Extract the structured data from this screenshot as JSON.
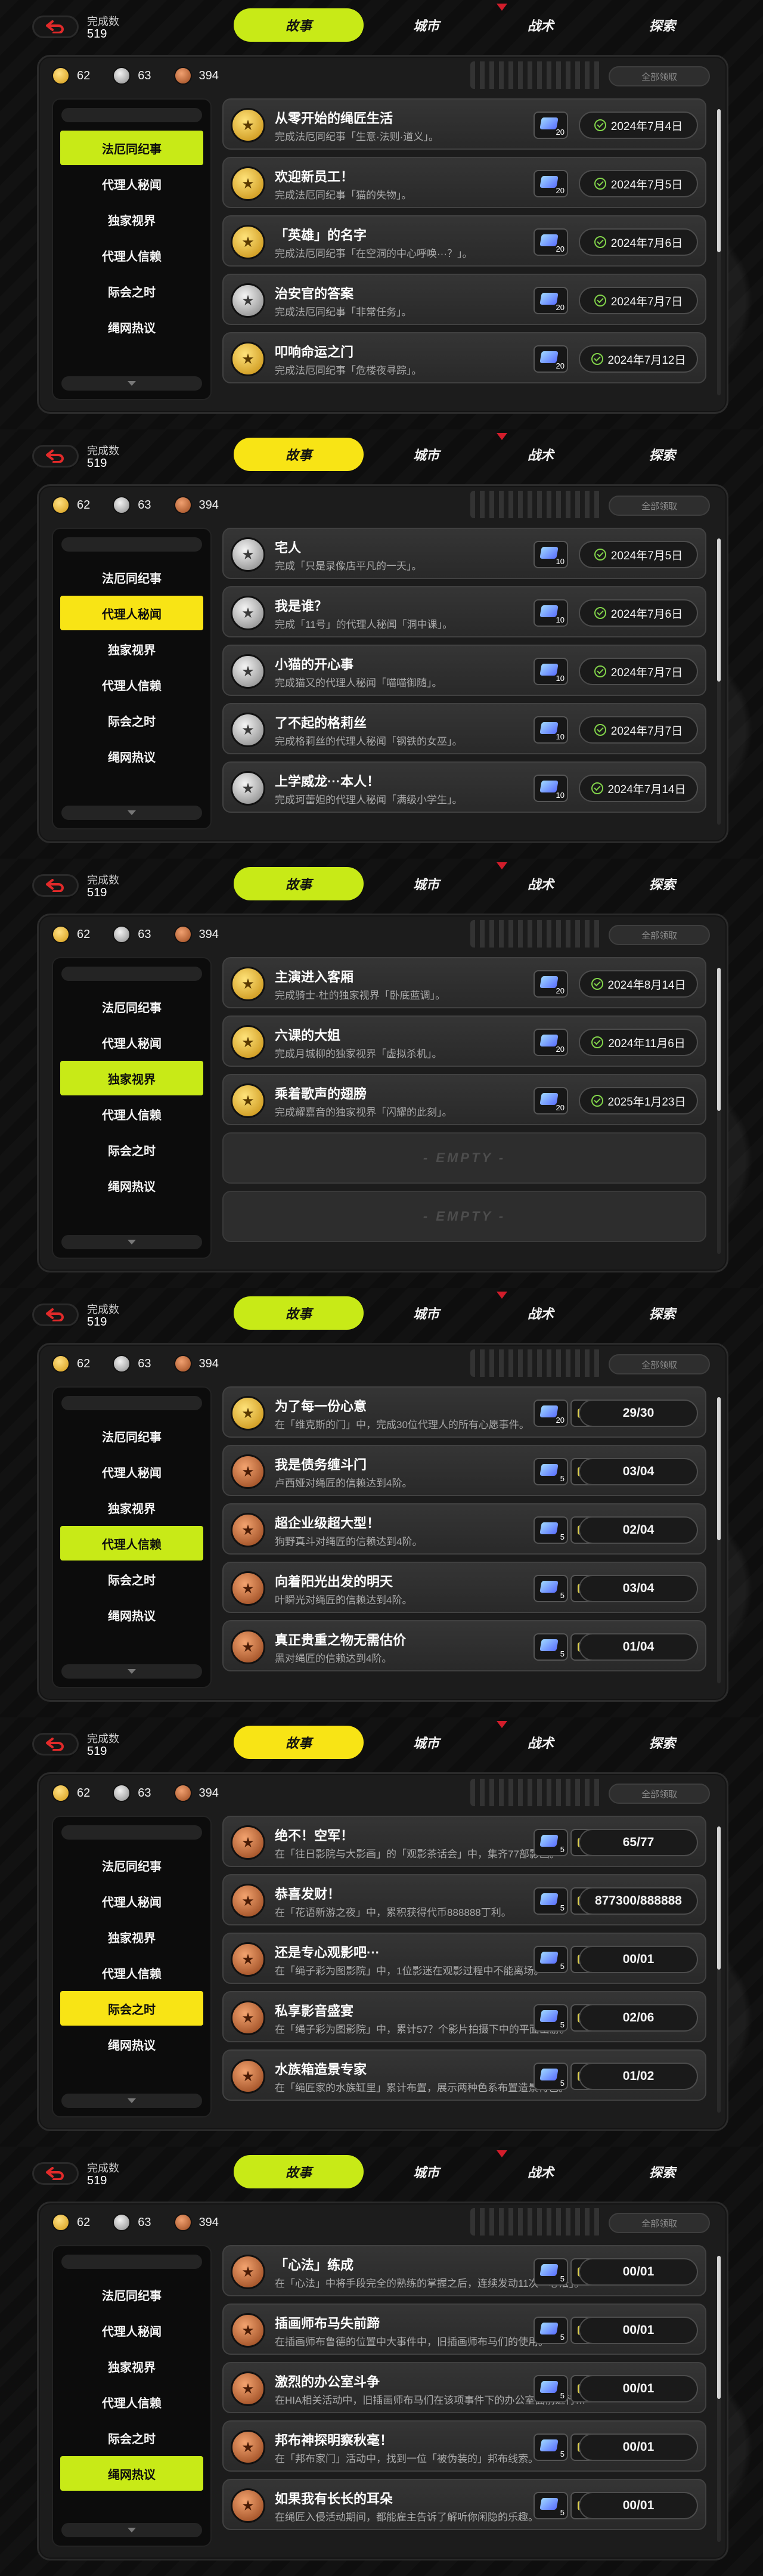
{
  "common": {
    "progress_label": "完成数",
    "progress_value": "519",
    "tabs": [
      "故事",
      "城市",
      "战术",
      "探索"
    ],
    "currencies": [
      {
        "icon": "gold-medal-icon",
        "count": "62"
      },
      {
        "icon": "silver-medal-icon",
        "count": "63"
      },
      {
        "icon": "bronze-medal-icon",
        "count": "394"
      }
    ],
    "claim_all": "全部领取",
    "categories": [
      "法厄同纪事",
      "代理人秘闻",
      "独家视界",
      "代理人信赖",
      "际会之时",
      "绳网热议"
    ],
    "empty_label": "- EMPTY -"
  },
  "colors": {
    "accent_lime": "#c8ea17",
    "accent_yellow": "#f8e415",
    "marker_red": "#d21d2b",
    "complete_check": "#82d44a"
  },
  "panels": [
    {
      "active_tab": 0,
      "active_category": 0,
      "active_color": "#c8ea17",
      "items": [
        {
          "medal": "gold",
          "title": "从零开始的绳匠生活",
          "desc": "完成法厄同纪事「生意·法则·道义」。",
          "reward": "20",
          "status": "2024年7月4日",
          "done": true
        },
        {
          "medal": "gold",
          "title": "欢迎新员工！",
          "desc": "完成法厄同纪事「猫的失物」。",
          "reward": "20",
          "status": "2024年7月5日",
          "done": true
        },
        {
          "medal": "gold",
          "title": "「英雄」的名字",
          "desc": "完成法厄同纪事「在空洞的中心呼唤···？」。",
          "reward": "20",
          "status": "2024年7月6日",
          "done": true
        },
        {
          "medal": "silver",
          "title": "治安官的答案",
          "desc": "完成法厄同纪事「非常任务」。",
          "reward": "20",
          "status": "2024年7月7日",
          "done": true
        },
        {
          "medal": "gold",
          "title": "叩响命运之门",
          "desc": "完成法厄同纪事「危楼夜寻踪」。",
          "reward": "20",
          "status": "2024年7月12日",
          "done": true
        }
      ]
    },
    {
      "active_tab": 0,
      "active_category": 1,
      "active_color": "#f8e415",
      "items": [
        {
          "medal": "silver",
          "title": "宅人",
          "desc": "完成「只是录像店平凡的一天」。",
          "reward": "10",
          "status": "2024年7月5日",
          "done": true
        },
        {
          "medal": "silver",
          "title": "我是谁？",
          "desc": "完成「11号」的代理人秘闻「洞中课」。",
          "reward": "10",
          "status": "2024年7月6日",
          "done": true
        },
        {
          "medal": "silver",
          "title": "小猫的开心事",
          "desc": "完成猫又的代理人秘闻「喵喵御随」。",
          "reward": "10",
          "status": "2024年7月7日",
          "done": true
        },
        {
          "medal": "silver",
          "title": "了不起的格莉丝",
          "desc": "完成格莉丝的代理人秘闻「钢铁的女巫」。",
          "reward": "10",
          "status": "2024年7月7日",
          "done": true
        },
        {
          "medal": "silver",
          "title": "上学威龙···本人！",
          "desc": "完成珂蕾妲的代理人秘闻「满级小学生」。",
          "reward": "10",
          "status": "2024年7月14日",
          "done": true
        }
      ]
    },
    {
      "active_tab": 0,
      "active_category": 2,
      "active_color": "#c8ea17",
      "items": [
        {
          "medal": "gold",
          "title": "主演进入客厢",
          "desc": "完成骑士·杜的独家视界「卧底蓝调」。",
          "reward": "20",
          "status": "2024年8月14日",
          "done": true
        },
        {
          "medal": "gold",
          "title": "六课的大姐",
          "desc": "完成月城柳的独家视界「虚拟杀机」。",
          "reward": "20",
          "status": "2024年11月6日",
          "done": true
        },
        {
          "medal": "gold",
          "title": "乘着歌声的翅膀",
          "desc": "完成耀嘉音的独家视界「闪耀的此刻」。",
          "reward": "20",
          "status": "2025年1月23日",
          "done": true
        }
      ],
      "empty_rows": 2
    },
    {
      "active_tab": 0,
      "active_category": 3,
      "active_color": "#c8ea17",
      "items": [
        {
          "medal": "gold",
          "title": "为了每一份心意",
          "desc": "在「维克斯的门」中，完成30位代理人的所有心愿事件。",
          "reward": "20",
          "status": "29/30",
          "done": false
        },
        {
          "medal": "bronze",
          "title": "我是债务缠斗门",
          "desc": "卢西娅对绳匠的信赖达到4阶。",
          "reward": "5",
          "status": "03/04",
          "done": false
        },
        {
          "medal": "bronze",
          "title": "超企业级超大型！",
          "desc": "狗野真斗对绳匠的信赖达到4阶。",
          "reward": "5",
          "status": "02/04",
          "done": false
        },
        {
          "medal": "bronze",
          "title": "向着阳光出发的明天",
          "desc": "叶瞬光对绳匠的信赖达到4阶。",
          "reward": "5",
          "status": "03/04",
          "done": false
        },
        {
          "medal": "bronze",
          "title": "真正贵重之物无需估价",
          "desc": "黑对绳匠的信赖达到4阶。",
          "reward": "5",
          "status": "01/04",
          "done": false
        }
      ]
    },
    {
      "active_tab": 0,
      "active_category": 4,
      "active_color": "#f8e415",
      "items": [
        {
          "medal": "bronze",
          "title": "绝不！空军！",
          "desc": "在「往日影院与大影画」的「观影茶话会」中，集齐77部影画。",
          "reward": "5",
          "status": "65/77",
          "done": false
        },
        {
          "medal": "bronze",
          "title": "恭喜发财！",
          "desc": "在「花语新游之夜」中，累积获得代币888888丁利。",
          "reward": "5",
          "status": "877300/888888",
          "done": false
        },
        {
          "medal": "bronze",
          "title": "还是专心观影吧···",
          "desc": "在「绳子彩为图影院」中，1位影迷在观影过程中不能离场。",
          "reward": "5",
          "status": "00/01",
          "done": false
        },
        {
          "medal": "bronze",
          "title": "私享影音盛宴",
          "desc": "在「绳子彩为图影院」中，累计57？个影片拍摄下中的平面出游。",
          "reward": "5",
          "status": "02/06",
          "done": false
        },
        {
          "medal": "bronze",
          "title": "水族箱造景专家",
          "desc": "在「绳匠家的水族缸里」累计布置，展示两种色系布置造景特色。",
          "reward": "5",
          "status": "01/02",
          "done": false
        }
      ]
    },
    {
      "active_tab": 0,
      "active_category": 5,
      "active_color": "#c8ea17",
      "items": [
        {
          "medal": "bronze",
          "title": "「心法」练成",
          "desc": "在「心法」中将手段完全的熟练的掌握之后，连续发动11次「心法」。",
          "reward": "5",
          "status": "00/01",
          "done": false
        },
        {
          "medal": "bronze",
          "title": "插画师布马失前蹄",
          "desc": "在插画师布鲁德的位置中大事件中，旧插画师布马们的使用。",
          "reward": "5",
          "status": "00/01",
          "done": false
        },
        {
          "medal": "bronze",
          "title": "激烈的办公室斗争",
          "desc": "在HIA相关活动中，旧插画师布马们在该项事件下的办公室面前进行…",
          "reward": "5",
          "status": "00/01",
          "done": false
        },
        {
          "medal": "bronze",
          "title": "邦布神探明察秋毫！",
          "desc": "在「邦布家门」活动中，找到一位「被伪装的」邦布线索。",
          "reward": "5",
          "status": "00/01",
          "done": false
        },
        {
          "medal": "bronze",
          "title": "如果我有长长的耳朵",
          "desc": "在绳匠入侵活动期间，都能雇主告诉了解听你闲隐的乐趣。",
          "reward": "5",
          "status": "00/01",
          "done": false
        }
      ]
    }
  ]
}
